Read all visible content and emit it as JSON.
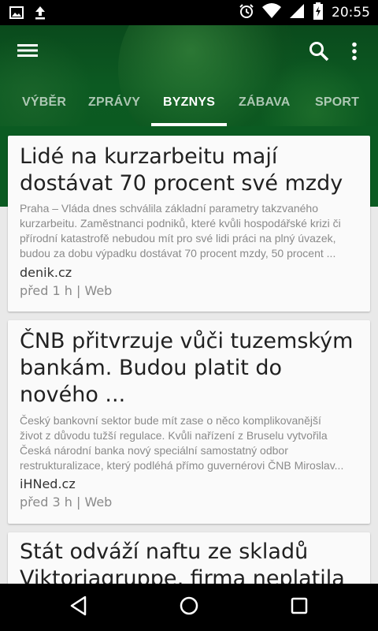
{
  "status_bar": {
    "time": "20:55",
    "left_icons": [
      "image-icon",
      "upload-icon"
    ],
    "right_icons": [
      "alarm-icon",
      "wifi-icon",
      "signal-icon",
      "battery-charging-icon"
    ]
  },
  "toolbar": {
    "menu_icon": "hamburger-menu-icon",
    "search_icon": "search-icon",
    "more_icon": "more-vertical-icon",
    "color": "#0b5b22"
  },
  "tabs": [
    {
      "label": "VÝBĚR",
      "active": false
    },
    {
      "label": "ZPRÁVY",
      "active": false
    },
    {
      "label": "BYZNYS",
      "active": true
    },
    {
      "label": "ZÁBAVA",
      "active": false
    },
    {
      "label": "SPORT",
      "active": false
    }
  ],
  "articles": [
    {
      "title_lines": [
        "Lidé na kurzarbeitu mají",
        "dostávat 70 procent své mzdy"
      ],
      "snippet_lines": [
        "Praha – Vláda dnes schválila základní parametry takzvaného",
        "kurzarbeitu. Zaměstnanci podniků, které kvůli hospodářské krizi či",
        "přírodní katastrofě nebudou mít pro své lidi práci na plný úvazek,",
        "budou za dobu výpadku dostávat 70 procent mzdy, 50 procent ..."
      ],
      "source": "denik.cz",
      "meta": "před 1 h | Web"
    },
    {
      "title_lines": [
        "ČNB přitvrzuje vůči tuzemským",
        "bankám. Budou platit do",
        "nového ..."
      ],
      "snippet_lines": [
        "Český bankovní sektor bude mít zase o něco komplikovanější",
        "život z důvodu tužší regulace. Kvůli nařízení z Bruselu vytvořila",
        "Česká národní banka nový speciální samostatný odbor",
        "restrukturalizace, který podléhá přímo guvernérovi ČNB Miroslav..."
      ],
      "source": "iHNed.cz",
      "meta": "před 3 h | Web"
    },
    {
      "title_lines": [
        "Stát odváží naftu ze skladů",
        "Viktoriagruppe, firma neplatila"
      ]
    }
  ],
  "nav_bar": {
    "back_icon": "back-triangle-icon",
    "home_icon": "home-circle-icon",
    "recents_icon": "recents-square-icon"
  }
}
